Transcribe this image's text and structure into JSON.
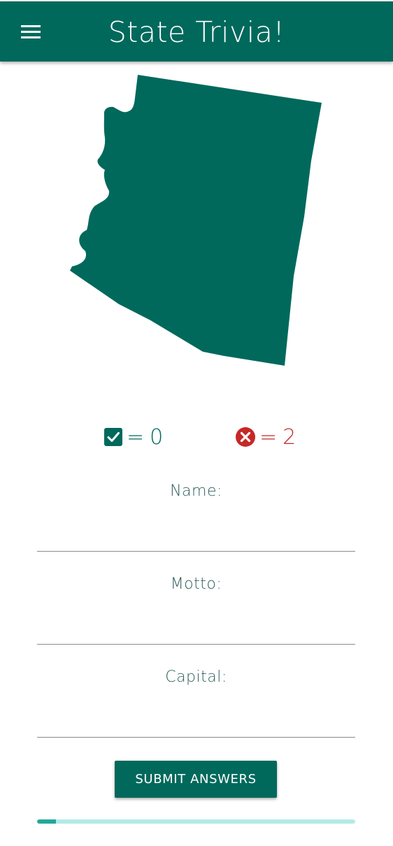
{
  "app": {
    "title": "State Trivia!",
    "colors": {
      "primary": "#00695c",
      "progress_track": "#b2ebe6",
      "progress_fill": "#26a69a",
      "wrong": "#c62828"
    }
  },
  "header": {
    "menu_icon": "hamburger-menu-icon"
  },
  "state_image": {
    "shape": "arizona-outline"
  },
  "score": {
    "correct_icon": "check-box-icon",
    "correct_equals": "=",
    "correct_count": "0",
    "wrong_icon": "cancel-circle-icon",
    "wrong_equals": "=",
    "wrong_count": "2"
  },
  "form": {
    "name_label": "Name:",
    "name_value": "",
    "motto_label": "Motto:",
    "motto_value": "",
    "capital_label": "Capital:",
    "capital_value": "",
    "submit_label": "SUBMIT ANSWERS"
  },
  "progress": {
    "fraction": 0.06
  }
}
